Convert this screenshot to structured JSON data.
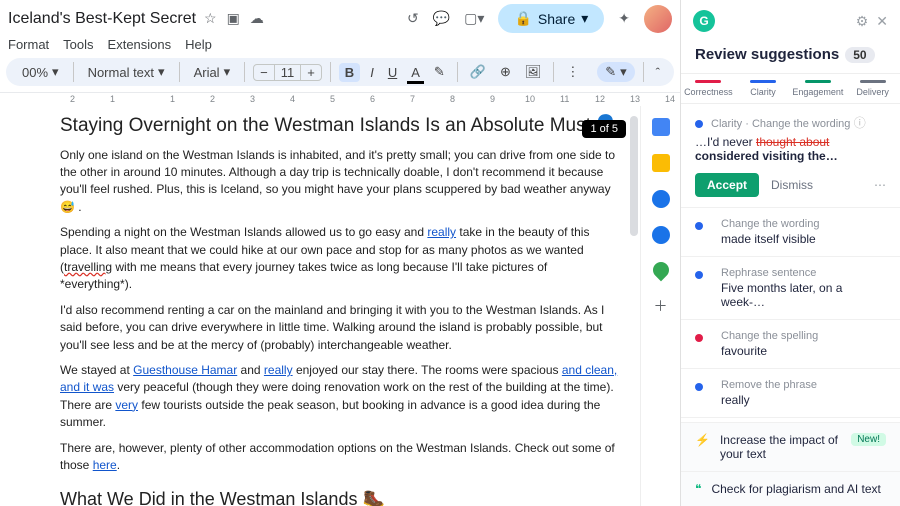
{
  "doc": {
    "title": "Iceland's Best-Kept Secret",
    "menus": [
      "Format",
      "Tools",
      "Extensions",
      "Help"
    ],
    "zoom": "00%",
    "style": "Normal text",
    "font": "Arial",
    "size": "11",
    "share": "Share",
    "find_badge": "1 of 5",
    "heading1": "Staying Overnight on the Westman Islands Is an Absolute Must",
    "p1": "Only one island on the Westman Islands is inhabited, and it's pretty small; you can drive from one side to the other in around 10 minutes. Although a day trip is technically doable, I don't recommend it because you'll feel rushed. Plus, this is Iceland, so you might have your plans scuppered by bad weather anyway 😅 .",
    "p2a": "Spending a night on the Westman Islands allowed us to go easy and ",
    "p2_link1": "really",
    "p2b": " take in the beauty of this place. It also meant that we could hike at our own pace and stop for as many photos as we wanted (",
    "p2_err": "travelling",
    "p2c": " with me means that every journey takes twice as long because I'll take pictures of *everything*).",
    "p3": "I'd also recommend renting a car on the mainland and bringing it with you to the Westman Islands. As I said before, you can drive everywhere in little time. Walking around the island is probably possible, but you'll see less and be at the mercy of (probably) interchangeable weather.",
    "p4a": "We stayed at ",
    "p4_link1": "Guesthouse Hamar",
    "p4b": " and ",
    "p4_link2": "really",
    "p4c": " enjoyed our stay there. The rooms were spacious ",
    "p4_u1": "and clean, and it was",
    "p4d": " very peaceful (though they were doing renovation work on the rest of the building at the time). There are ",
    "p4_u2": "very",
    "p4e": " few tourists outside the peak season, but booking in advance is a good idea during the summer.",
    "p5a": "There are, however, plenty of other accommodation options on the Westman Islands. Check out some of those ",
    "p5_link": "here",
    "p5b": ".",
    "heading2": "What We Did in the Westman Islands 🥾"
  },
  "grammarly": {
    "title": "Review suggestions",
    "count": "50",
    "tabs": [
      {
        "label": "Correctness",
        "color": "#e11d48"
      },
      {
        "label": "Clarity",
        "color": "#2563eb"
      },
      {
        "label": "Engagement",
        "color": "#059669"
      },
      {
        "label": "Delivery",
        "color": "#6b7280"
      }
    ],
    "main": {
      "category": "Clarity · Change the wording",
      "text_a": "…I'd never ",
      "strike": "thought about",
      "text_b": " considered visiting the…",
      "accept": "Accept",
      "dismiss": "Dismiss"
    },
    "items": [
      {
        "dot": "#2563eb",
        "lbl": "Change the wording",
        "val": "made itself visible"
      },
      {
        "dot": "#2563eb",
        "lbl": "Rephrase sentence",
        "val": "Five months later, on a week-…"
      },
      {
        "dot": "#e11d48",
        "lbl": "Change the spelling",
        "val": "favourite"
      },
      {
        "dot": "#2563eb",
        "lbl": "Remove the phrase",
        "val": "really"
      }
    ],
    "foot1": "Increase the impact of your text",
    "foot1_badge": "New!",
    "foot2": "Check for plagiarism and AI text"
  }
}
